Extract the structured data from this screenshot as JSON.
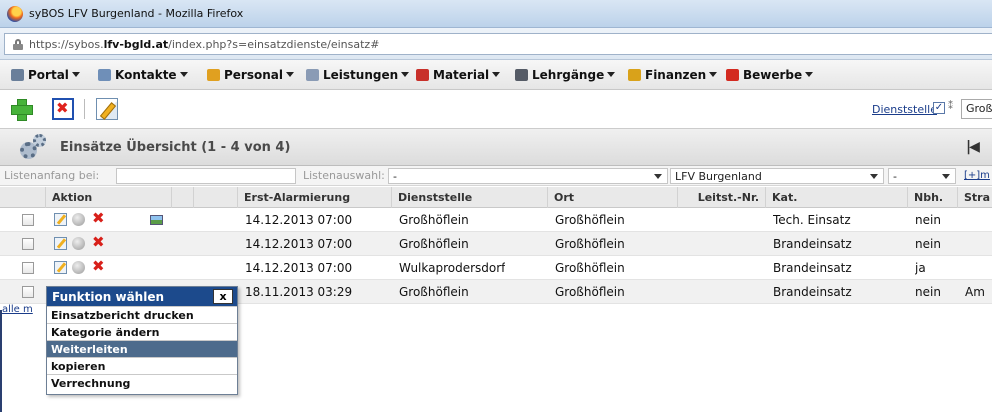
{
  "window": {
    "title": "syBOS LFV Burgenland - Mozilla Firefox"
  },
  "address": {
    "url_prefix": "https://sybos.",
    "url_domain": "lfv-bgld.at",
    "url_path": "/index.php?s=einsatzdienste/einsatz#"
  },
  "menu": [
    {
      "label": "Portal",
      "icon_color": "#6a7f9a"
    },
    {
      "label": "Kontakte",
      "icon_color": "#6f8fb8"
    },
    {
      "label": "Personal",
      "icon_color": "#e0a020"
    },
    {
      "label": "Leistungen",
      "icon_color": "#8a9bb5"
    },
    {
      "label": "Material",
      "icon_color": "#c8302a"
    },
    {
      "label": "Lehrgänge",
      "icon_color": "#555b66"
    },
    {
      "label": "Finanzen",
      "icon_color": "#d9a21a"
    },
    {
      "label": "Bewerbe",
      "icon_color": "#d32a20"
    }
  ],
  "toolbar": {
    "dienststelle_label": "Dienststelle",
    "dienststelle_checked": "✓",
    "dienststelle_value": "Groß"
  },
  "page": {
    "title": "Einsätze Übersicht (1 - 4 von 4)"
  },
  "filters": {
    "listenanfang_label": "Listenanfang bei:",
    "listenauswahl_label": "Listenauswahl:",
    "listenauswahl_value": "-",
    "org_value": "LFV Burgenland",
    "small_value": "-",
    "more_label": "[+]m"
  },
  "table": {
    "headers": {
      "aktion": "Aktion",
      "erst_alarmierung": "Erst-Alarmierung",
      "dienststelle": "Dienststelle",
      "ort": "Ort",
      "leitst_nr": "Leitst.-Nr.",
      "kat": "Kat.",
      "nbh": "Nbh.",
      "strasse": "Stra"
    },
    "rows": [
      {
        "erst_alarmierung": "14.12.2013 07:00",
        "dienststelle": "Großhöflein",
        "ort": "Großhöflein",
        "leitst_nr": "",
        "kat": "Tech. Einsatz",
        "nbh": "nein",
        "strasse": ""
      },
      {
        "erst_alarmierung": "14.12.2013 07:00",
        "dienststelle": "Großhöflein",
        "ort": "Großhöflein",
        "leitst_nr": "",
        "kat": "Brandeinsatz",
        "nbh": "nein",
        "strasse": ""
      },
      {
        "erst_alarmierung": "14.12.2013 07:00",
        "dienststelle": "Wulkaprodersdorf",
        "ort": "Großhöflein",
        "leitst_nr": "",
        "kat": "Brandeinsatz",
        "nbh": "ja",
        "strasse": ""
      },
      {
        "erst_alarmierung": "18.11.2013 03:29",
        "dienststelle": "Großhöflein",
        "ort": "Großhöflein",
        "leitst_nr": "",
        "kat": "Brandeinsatz",
        "nbh": "nein",
        "strasse": "Am"
      }
    ]
  },
  "alle_link": "alle m",
  "popup": {
    "title": "Funktion wählen",
    "close": "x",
    "items": [
      "Einsatzbericht drucken",
      "Kategorie ändern",
      "Weiterleiten",
      "kopieren",
      "Verrechnung"
    ],
    "highlighted": "Weiterleiten"
  }
}
